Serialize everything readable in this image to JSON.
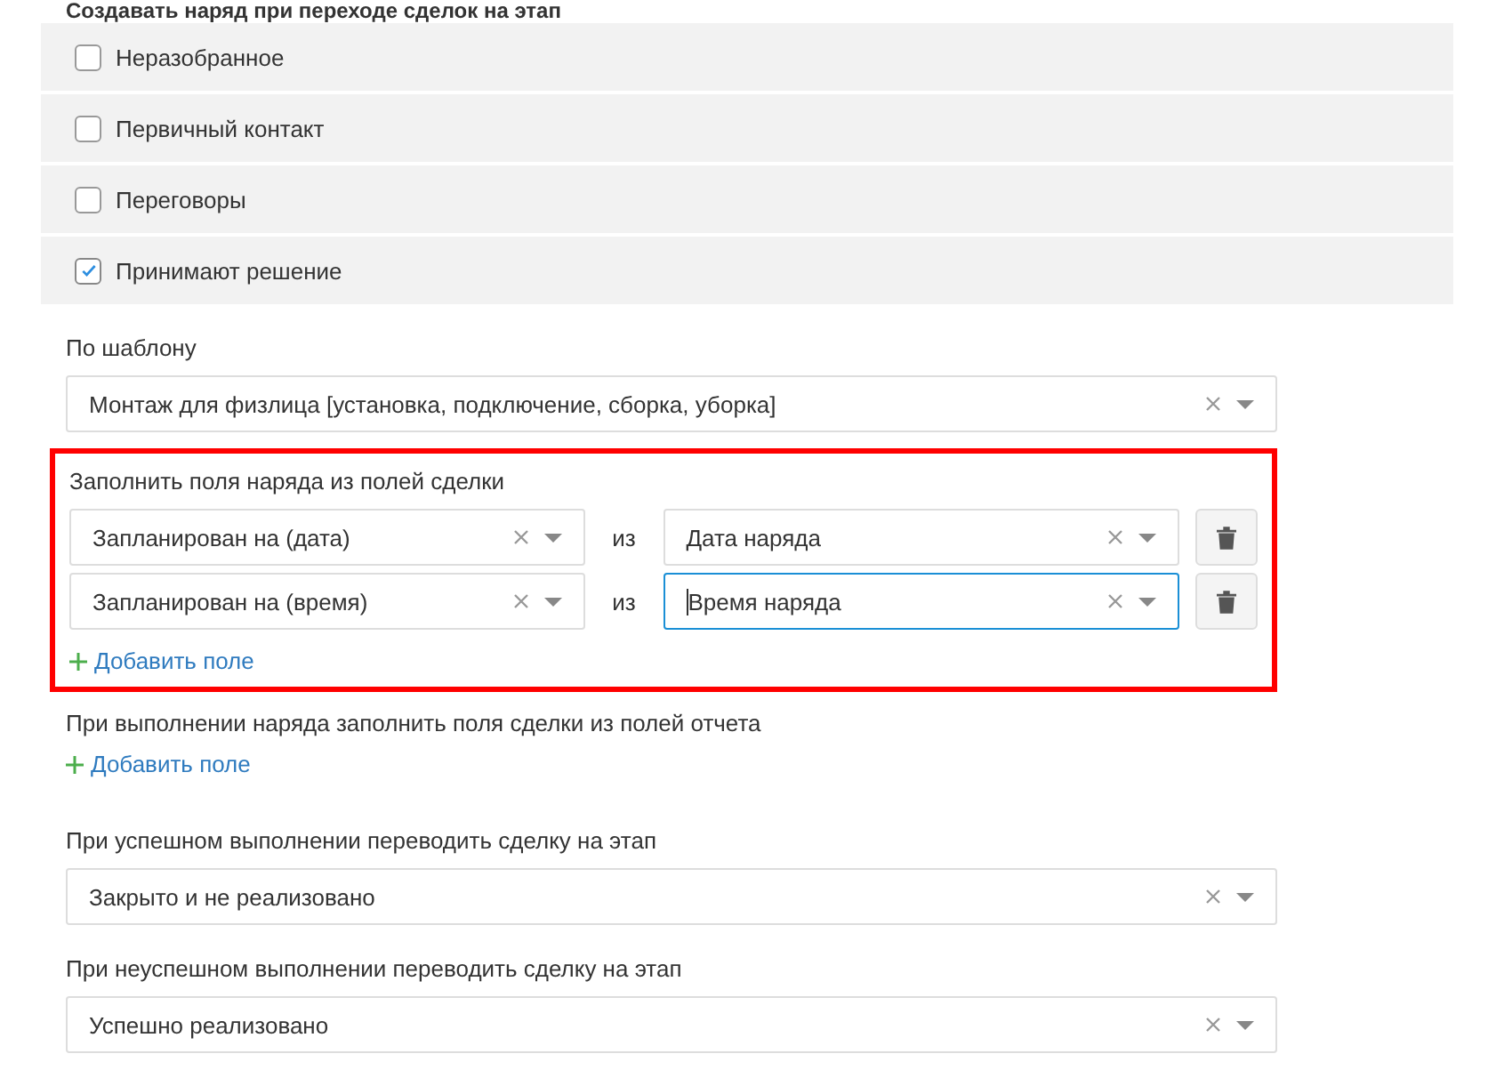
{
  "section_title": "Создавать наряд при переходе сделок на этап",
  "stages": [
    {
      "label": "Неразобранное",
      "checked": false
    },
    {
      "label": "Первичный контакт",
      "checked": false
    },
    {
      "label": "Переговоры",
      "checked": false
    },
    {
      "label": "Принимают решение",
      "checked": true
    }
  ],
  "template": {
    "label": "По шаблону",
    "value": "Монтаж для физлица [установка, подключение, сборка, уборка]"
  },
  "fill_order_fields": {
    "label": "Заполнить поля наряда из полей сделки",
    "highlighted": true,
    "mappings": [
      {
        "target": {
          "value": "Запланирован на (дата)",
          "focused": false
        },
        "separator": "из",
        "source": {
          "value": "Дата наряда",
          "focused": false
        }
      },
      {
        "target": {
          "value": "Запланирован на (время)",
          "focused": false
        },
        "separator": "из",
        "source": {
          "value": "Время наряда",
          "focused": true
        }
      }
    ],
    "add_link": "Добавить поле"
  },
  "fill_deal_fields": {
    "label": "При выполнении наряда заполнить поля сделки из полей отчета",
    "add_link": "Добавить поле"
  },
  "on_success": {
    "label": "При успешном выполнении переводить сделку на этап",
    "value": "Закрыто и не реализовано"
  },
  "on_failure": {
    "label": "При неуспешном выполнении переводить сделку на этап",
    "value": "Успешно реализовано"
  }
}
